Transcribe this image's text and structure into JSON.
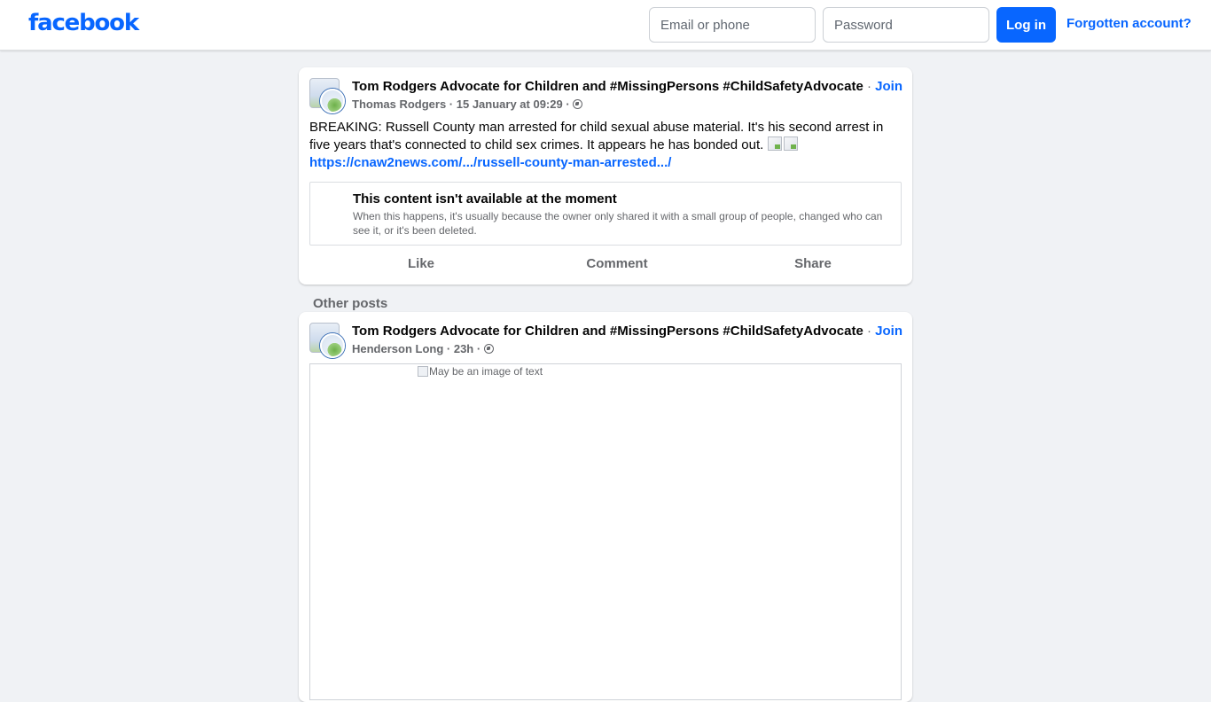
{
  "header": {
    "logo": "facebook",
    "email_placeholder": "Email or phone",
    "password_placeholder": "Password",
    "login_label": "Log in",
    "forgot_label": "Forgotten account?",
    "brand_color": "#0866ff"
  },
  "post1": {
    "group_name": "Tom Rodgers Advocate for Children and #MissingPersons #ChildSafetyAdvocate",
    "separator": " · ",
    "join_label": "Join",
    "author": "Thomas Rodgers",
    "timestamp": "15 January at 09:29",
    "privacy_icon": "globe-icon",
    "text": "BREAKING: Russell County man arrested for child sexual abuse material. It's his second arrest in five years that's connected to child sex crimes. It appears he has bonded out.",
    "link": "https://cnaw2news.com/.../russell-county-man-arrested.../",
    "unavailable_title": "This content isn't available at the moment",
    "unavailable_desc": "When this happens, it's usually because the owner only shared it with a small group of people, changed who can see it, or it's been deleted.",
    "actions": {
      "like": "Like",
      "comment": "Comment",
      "share": "Share"
    }
  },
  "other_posts_label": "Other posts",
  "post2": {
    "group_name": "Tom Rodgers Advocate for Children and #MissingPersons #ChildSafetyAdvocate",
    "separator": " · ",
    "join_label": "Join",
    "author": "Henderson Long",
    "timestamp": "23h",
    "privacy_icon": "globe-icon",
    "image_alt": "May be an image of text"
  }
}
